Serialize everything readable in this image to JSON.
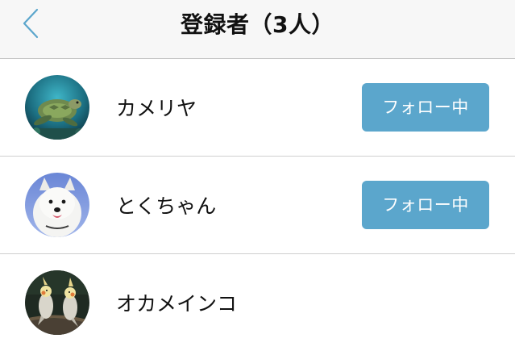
{
  "header": {
    "title": "登録者（3人）",
    "back_icon": "chevron-left-icon"
  },
  "colors": {
    "nav_background": "#f7f7f7",
    "follow_button": "#5ba6cc",
    "back_chevron": "#5ba6cc"
  },
  "registrants": [
    {
      "name": "カメリヤ",
      "avatar": "sea-turtle-photo",
      "button_label": "フォロー中"
    },
    {
      "name": "とくちゃん",
      "avatar": "white-dog-photo",
      "button_label": "フォロー中"
    },
    {
      "name": "オカメインコ",
      "avatar": "cockatiel-birds-photo"
    }
  ]
}
